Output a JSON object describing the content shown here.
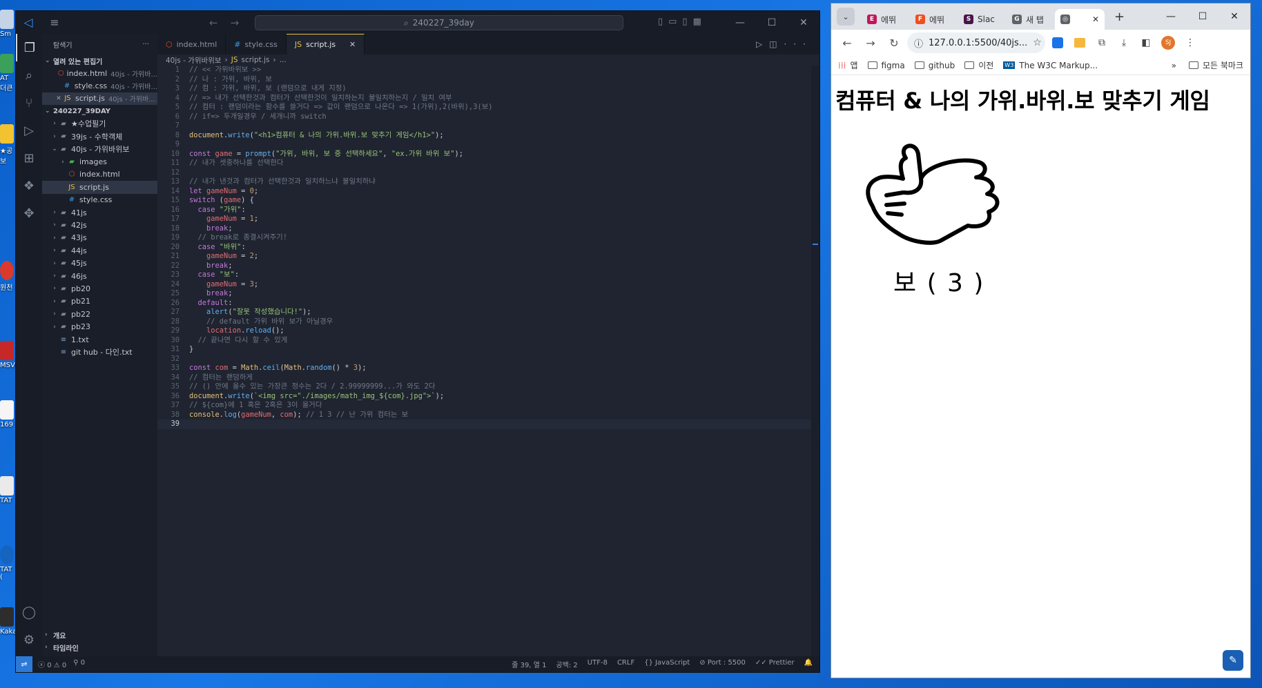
{
  "desktop": {
    "icons": [
      {
        "label": "Sm"
      },
      {
        "label": "AT\n더큰"
      },
      {
        "label": "★공\n보"
      },
      {
        "label": "원천"
      },
      {
        "label": "MSV"
      },
      {
        "label": "169"
      },
      {
        "label": "TAT"
      },
      {
        "label": "TAT\n("
      },
      {
        "label": "Kaka"
      }
    ]
  },
  "vscode": {
    "search_text": "240227_39day",
    "sidebar": {
      "title": "탐색기",
      "open_editors_label": "열려 있는 편집기",
      "open_editors": [
        {
          "name": "index.html",
          "path": "40js - 가위바...",
          "type": "html"
        },
        {
          "name": "style.css",
          "path": "40js - 가위바...",
          "type": "css"
        },
        {
          "name": "script.js",
          "path": "40js - 가위바...",
          "type": "js"
        }
      ],
      "workspace_label": "240227_39DAY",
      "tree": [
        {
          "label": "★수업필기",
          "type": "folder",
          "depth": 1,
          "open": false
        },
        {
          "label": "39js - 수학객체",
          "type": "folder",
          "depth": 1,
          "open": false
        },
        {
          "label": "40js - 가위바위보",
          "type": "folder",
          "depth": 1,
          "open": true
        },
        {
          "label": "images",
          "type": "folder",
          "depth": 2,
          "open": false
        },
        {
          "label": "index.html",
          "type": "html",
          "depth": 2
        },
        {
          "label": "script.js",
          "type": "js",
          "depth": 2,
          "selected": true
        },
        {
          "label": "style.css",
          "type": "css",
          "depth": 2
        },
        {
          "label": "41js",
          "type": "folder",
          "depth": 1,
          "open": false
        },
        {
          "label": "42js",
          "type": "folder",
          "depth": 1,
          "open": false
        },
        {
          "label": "43js",
          "type": "folder",
          "depth": 1,
          "open": false
        },
        {
          "label": "44js",
          "type": "folder",
          "depth": 1,
          "open": false
        },
        {
          "label": "45js",
          "type": "folder",
          "depth": 1,
          "open": false
        },
        {
          "label": "46js",
          "type": "folder",
          "depth": 1,
          "open": false
        },
        {
          "label": "pb20",
          "type": "folder",
          "depth": 1,
          "open": false
        },
        {
          "label": "pb21",
          "type": "folder",
          "depth": 1,
          "open": false
        },
        {
          "label": "pb22",
          "type": "folder",
          "depth": 1,
          "open": false
        },
        {
          "label": "pb23",
          "type": "folder",
          "depth": 1,
          "open": false
        },
        {
          "label": "1.txt",
          "type": "txt",
          "depth": 1
        },
        {
          "label": "git hub - 다인.txt",
          "type": "txt",
          "depth": 1
        }
      ],
      "outline_label": "개요",
      "timeline_label": "타임라인"
    },
    "tabs": [
      {
        "label": "index.html",
        "type": "html"
      },
      {
        "label": "style.css",
        "type": "css"
      },
      {
        "label": "script.js",
        "type": "js",
        "active": true
      }
    ],
    "breadcrumb": [
      "40js - 가위바위보",
      "script.js",
      "..."
    ],
    "current_line": 39,
    "code_lines": [
      [
        [
          "c-com",
          "// << 가위바위보 >>"
        ]
      ],
      [
        [
          "c-com",
          "// 나 : 가위, 바위, 보"
        ]
      ],
      [
        [
          "c-com",
          "// 컴 : 가위, 바위, 보 (랜덤으로 내게 지정)"
        ]
      ],
      [
        [
          "c-com",
          "// => 내가 선택한것과 컴터가 선택한것이 일치하는지 불일치하는지 / 일치 여부"
        ]
      ],
      [
        [
          "c-com",
          "// 컴터 : 랜덤이라는 함수를 쓸거다 => 값이 랜덤으로 나온다 => 1(가위),2(바위),3(보)"
        ]
      ],
      [
        [
          "c-com",
          "// if=> 두개일경우 / 세개니까 switch"
        ]
      ],
      [],
      [
        [
          "c-fn",
          "document"
        ],
        [
          "",
          "."
        ],
        [
          "c-prop",
          "write"
        ],
        [
          "",
          "("
        ],
        [
          "c-str",
          "\"<h1>컴퓨터 & 나의 가위.바위.보 맞추기 게임</h1>\""
        ],
        [
          "",
          ");"
        ]
      ],
      [],
      [
        [
          "c-kw",
          "const "
        ],
        [
          "c-var",
          "game"
        ],
        [
          "",
          " = "
        ],
        [
          "c-prop",
          "prompt"
        ],
        [
          "",
          "("
        ],
        [
          "c-str",
          "\"가위, 바위, 보 중 선택하세요\""
        ],
        [
          "",
          ", "
        ],
        [
          "c-str",
          "\"ex.가위 바위 보\""
        ],
        [
          "",
          ");"
        ]
      ],
      [
        [
          "c-com",
          "// 내가 셋중하나를 선택한다"
        ]
      ],
      [],
      [
        [
          "c-com",
          "// 내가 낸것과 컴터가 선택한것과 일치하느냐 불일치하냐"
        ]
      ],
      [
        [
          "c-kw",
          "let "
        ],
        [
          "c-var",
          "gameNum"
        ],
        [
          "",
          " = "
        ],
        [
          "c-num",
          "0"
        ],
        [
          "",
          ";"
        ]
      ],
      [
        [
          "c-kw",
          "switch "
        ],
        [
          "",
          "("
        ],
        [
          "c-var",
          "game"
        ],
        [
          "",
          ") {"
        ]
      ],
      [
        [
          "",
          "  "
        ],
        [
          "c-kw",
          "case "
        ],
        [
          "c-str",
          "\"가위\""
        ],
        [
          "",
          ":"
        ]
      ],
      [
        [
          "",
          "    "
        ],
        [
          "c-var",
          "gameNum"
        ],
        [
          "",
          " = "
        ],
        [
          "c-num",
          "1"
        ],
        [
          "",
          ";"
        ]
      ],
      [
        [
          "",
          "    "
        ],
        [
          "c-kw",
          "break"
        ],
        [
          "",
          ";"
        ]
      ],
      [
        [
          "",
          "  "
        ],
        [
          "c-com",
          "// break로 종결시켜주기!"
        ]
      ],
      [
        [
          "",
          "  "
        ],
        [
          "c-kw",
          "case "
        ],
        [
          "c-str",
          "\"바위\""
        ],
        [
          "",
          ":"
        ]
      ],
      [
        [
          "",
          "    "
        ],
        [
          "c-var",
          "gameNum"
        ],
        [
          "",
          " = "
        ],
        [
          "c-num",
          "2"
        ],
        [
          "",
          ";"
        ]
      ],
      [
        [
          "",
          "    "
        ],
        [
          "c-kw",
          "break"
        ],
        [
          "",
          ";"
        ]
      ],
      [
        [
          "",
          "  "
        ],
        [
          "c-kw",
          "case "
        ],
        [
          "c-str",
          "\"보\""
        ],
        [
          "",
          ":"
        ]
      ],
      [
        [
          "",
          "    "
        ],
        [
          "c-var",
          "gameNum"
        ],
        [
          "",
          " = "
        ],
        [
          "c-num",
          "3"
        ],
        [
          "",
          ";"
        ]
      ],
      [
        [
          "",
          "    "
        ],
        [
          "c-kw",
          "break"
        ],
        [
          "",
          ";"
        ]
      ],
      [
        [
          "",
          "  "
        ],
        [
          "c-kw",
          "default"
        ],
        [
          "",
          ":"
        ]
      ],
      [
        [
          "",
          "    "
        ],
        [
          "c-prop",
          "alert"
        ],
        [
          "",
          "("
        ],
        [
          "c-str",
          "\"잘못 작성했습니다!\""
        ],
        [
          "",
          ");"
        ]
      ],
      [
        [
          "",
          "    "
        ],
        [
          "c-com",
          "// default 가위 바위 보가 아닐경우"
        ]
      ],
      [
        [
          "",
          "    "
        ],
        [
          "c-var",
          "location"
        ],
        [
          "",
          "."
        ],
        [
          "c-prop",
          "reload"
        ],
        [
          "",
          "();"
        ]
      ],
      [
        [
          "",
          "  "
        ],
        [
          "c-com",
          "// 끝나면 다시 할 수 있게"
        ]
      ],
      [
        [
          "",
          "}"
        ]
      ],
      [],
      [
        [
          "c-kw",
          "const "
        ],
        [
          "c-var",
          "com"
        ],
        [
          "",
          " = "
        ],
        [
          "c-fn",
          "Math"
        ],
        [
          "",
          "."
        ],
        [
          "c-prop",
          "ceil"
        ],
        [
          "",
          "("
        ],
        [
          "c-fn",
          "Math"
        ],
        [
          "",
          "."
        ],
        [
          "c-prop",
          "random"
        ],
        [
          "",
          "() * "
        ],
        [
          "c-num",
          "3"
        ],
        [
          "",
          ");"
        ]
      ],
      [
        [
          "c-com",
          "// 컴터는 랜덤하게"
        ]
      ],
      [
        [
          "c-com",
          "// () 안에 올수 있는 가장큰 정수는 2다 / 2.99999999...가 와도 2다"
        ]
      ],
      [
        [
          "c-fn",
          "document"
        ],
        [
          "",
          "."
        ],
        [
          "c-prop",
          "write"
        ],
        [
          "",
          "("
        ],
        [
          "c-str",
          "`<img src=\"./images/math_img_${com}.jpg\">`"
        ],
        [
          "",
          ");"
        ]
      ],
      [
        [
          "c-com",
          "// ${com}에 1 혹은 2혹은 3이 올거다"
        ]
      ],
      [
        [
          "c-fn",
          "console"
        ],
        [
          "",
          "."
        ],
        [
          "c-prop",
          "log"
        ],
        [
          "",
          "("
        ],
        [
          "c-var",
          "gameNum"
        ],
        [
          "",
          ", "
        ],
        [
          "c-var",
          "com"
        ],
        [
          "",
          "); "
        ],
        [
          "c-com",
          "// 1 3 // 난 가위 컴터는 보"
        ]
      ],
      []
    ],
    "status": {
      "errors": "0",
      "warnings": "0",
      "ports": "0",
      "position": "줄 39, 열 1",
      "spaces": "공백: 2",
      "encoding": "UTF-8",
      "eol": "CRLF",
      "language": "JavaScript",
      "port": "Port : 5500",
      "prettier": "Prettier"
    }
  },
  "chrome": {
    "tabs": [
      {
        "label": "에뛰",
        "fav": "E",
        "color": "#c2185b"
      },
      {
        "label": "에뛰",
        "fav": "F",
        "color": "#f24e1e"
      },
      {
        "label": "Slac",
        "fav": "S",
        "color": "#4a154b"
      },
      {
        "label": "새 탭",
        "fav": "G",
        "color": "#5f6368"
      },
      {
        "label": "",
        "fav": "◎",
        "color": "#5f6368",
        "active": true
      }
    ],
    "url": "127.0.0.1:5500/40js...",
    "avatar": "SJ",
    "bookmarks": [
      {
        "label": "앱",
        "kind": "apps"
      },
      {
        "label": "figma",
        "kind": "folder"
      },
      {
        "label": "github",
        "kind": "folder"
      },
      {
        "label": "이전",
        "kind": "folder"
      },
      {
        "label": "The W3C Markup...",
        "kind": "w3c"
      }
    ],
    "all_bookmarks": "모든 북마크",
    "page": {
      "heading": "컴퓨터 & 나의 가위.바위.보 맞추기 게임",
      "caption": "보 ( 3 )"
    }
  }
}
